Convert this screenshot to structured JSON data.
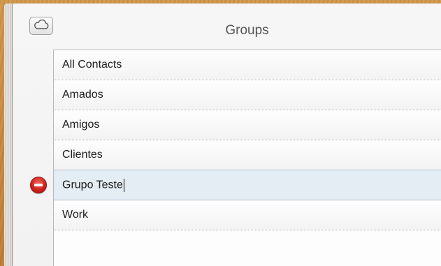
{
  "header": {
    "title": "Groups",
    "cloud_icon": "cloud-icon"
  },
  "groups": {
    "items": [
      {
        "label": "All Contacts",
        "selected": false
      },
      {
        "label": "Amados",
        "selected": false
      },
      {
        "label": "Amigos",
        "selected": false
      },
      {
        "label": "Clientes",
        "selected": false
      },
      {
        "label": "Grupo Teste",
        "selected": true,
        "editing": true
      },
      {
        "label": "Work",
        "selected": false
      }
    ]
  },
  "controls": {
    "delete_icon": "minus-circle-icon",
    "delete_color": "#cf1f1a"
  }
}
